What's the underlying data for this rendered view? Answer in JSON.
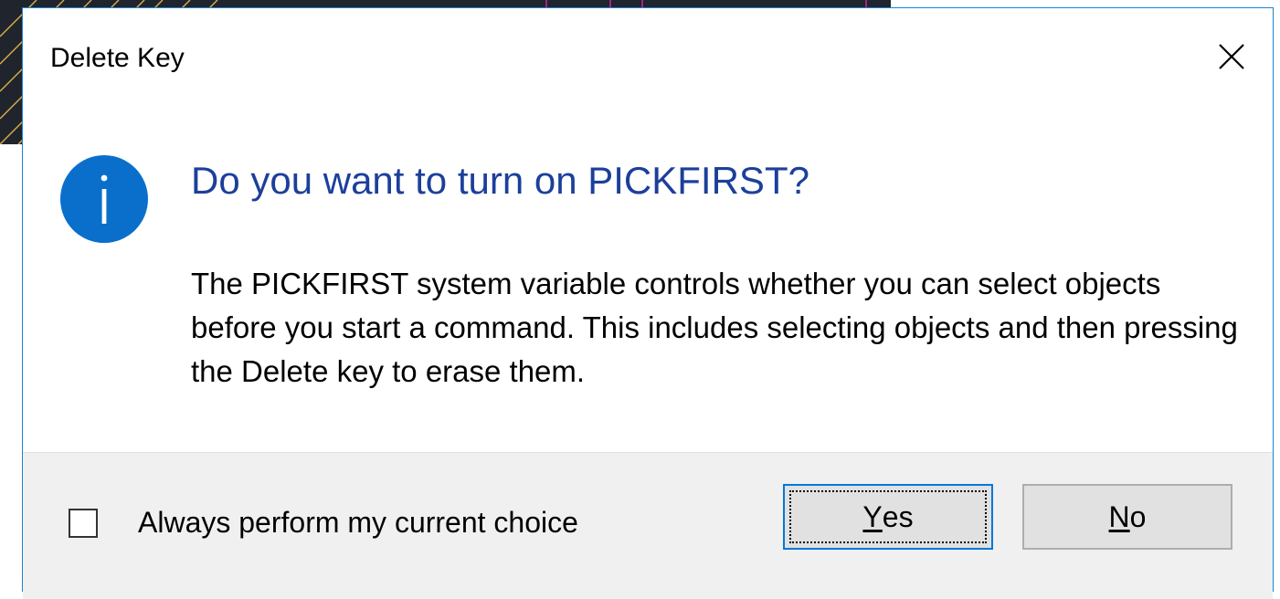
{
  "dialog": {
    "title": "Delete Key",
    "heading": "Do you want to turn on PICKFIRST?",
    "message": "The PICKFIRST system variable controls whether you can select objects before you start a command. This includes selecting objects and then pressing the Delete key to erase them.",
    "icon": "info-icon",
    "close_icon": "close-icon"
  },
  "footer": {
    "checkbox_label": "Always perform my current choice",
    "checkbox_checked": false,
    "yes": {
      "mnemonic": "Y",
      "rest": "es"
    },
    "no": {
      "mnemonic": "N",
      "rest": "o"
    }
  },
  "colors": {
    "heading": "#1c3f9a",
    "icon": "#0a6fcb",
    "accent_border": "#0078d7",
    "footer_bg": "#f0f0f0",
    "background_canvas": "#20242c"
  }
}
